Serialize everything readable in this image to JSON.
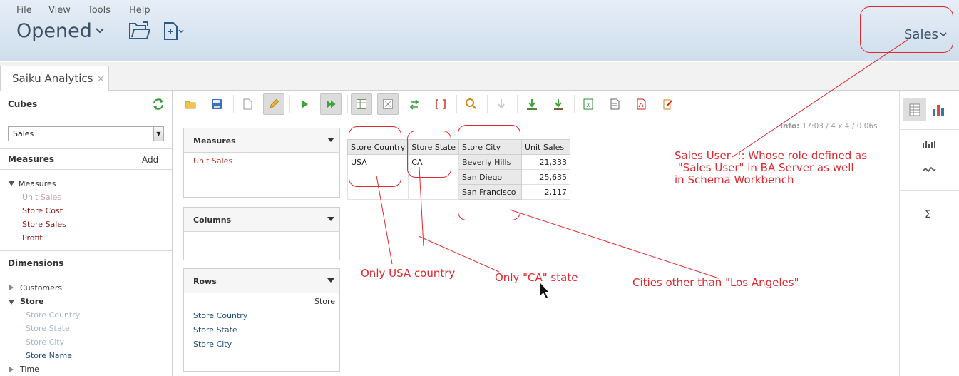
{
  "menu": {
    "file": "File",
    "view": "View",
    "tools": "Tools",
    "help": "Help"
  },
  "header": {
    "opened": "Opened",
    "user": "Sales"
  },
  "tab": {
    "label": "Saiku Analytics",
    "close": "×"
  },
  "left": {
    "cubes_title": "Cubes",
    "cube_selected": "Sales",
    "measures_title": "Measures",
    "add_label": "Add",
    "measures_group": "Measures",
    "measures": [
      "Unit Sales",
      "Store Cost",
      "Store Sales",
      "Profit"
    ],
    "dimensions_title": "Dimensions",
    "customers": "Customers",
    "store": "Store",
    "store_levels": [
      "Store Country",
      "Store State",
      "Store City",
      "Store Name"
    ],
    "time": "Time"
  },
  "query": {
    "measures_title": "Measures",
    "measures_items": [
      "Unit Sales"
    ],
    "columns_title": "Columns",
    "rows_title": "Rows",
    "rows_dimension": "Store",
    "rows_items": [
      "Store Country",
      "Store State",
      "Store City"
    ]
  },
  "info": {
    "label": "Info:",
    "time": "17:03",
    "size": "/ 4 x 4",
    "duration": "/ 0.06s"
  },
  "table": {
    "headers": [
      "Store Country",
      "Store State",
      "Store City",
      "Unit Sales"
    ],
    "country": "USA",
    "state": "CA",
    "rows": [
      {
        "city": "Beverly Hills",
        "sales": "21,333"
      },
      {
        "city": "San Diego",
        "sales": "25,635"
      },
      {
        "city": "San Francisco",
        "sales": "2,117"
      }
    ]
  },
  "annotations": {
    "sales_user": "Sales User  :: Whose role defined as\n \"Sales User\" in BA Server as well\nin Schema Workbench",
    "country": "Only USA country",
    "state": "Only \"CA\" state",
    "cities": "Cities other than \"Los Angeles\""
  },
  "colors": {
    "annotation": "#e0282f",
    "measure": "#8b1a1a",
    "level": "#1f4d7a",
    "header_bg": "#d6e3f0"
  },
  "icons": [
    "folder-open-icon",
    "save-icon",
    "new-query-icon",
    "edit-icon",
    "run-icon",
    "auto-run-icon",
    "toggle-fields-icon",
    "hide-parents-icon",
    "swap-axis-icon",
    "non-empty-icon",
    "zoom-icon",
    "drillthrough-icon",
    "export-drillthrough-icon",
    "export-xls-icon",
    "export-csv-icon",
    "export-pdf-icon",
    "mdx-icon",
    "table-view-icon",
    "chart-view-icon",
    "sparkbar-icon",
    "sparkline-icon",
    "sum-icon"
  ]
}
